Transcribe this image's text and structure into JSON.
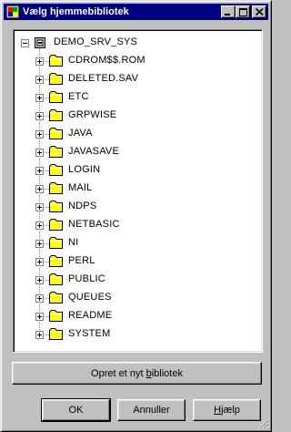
{
  "window": {
    "title": "Vælg hjemmebibliotek",
    "icon": "app-icon",
    "controls": [
      "minimize-icon",
      "maximize-icon",
      "close-icon"
    ]
  },
  "tree": {
    "root": {
      "label": "DEMO_SRV_SYS",
      "icon": "server-volume-icon",
      "expanded": true
    },
    "folders": [
      {
        "label": "CDROM$$.ROM"
      },
      {
        "label": "DELETED.SAV"
      },
      {
        "label": "ETC"
      },
      {
        "label": "GRPWISE"
      },
      {
        "label": "JAVA"
      },
      {
        "label": "JAVASAVE"
      },
      {
        "label": "LOGIN"
      },
      {
        "label": "MAIL"
      },
      {
        "label": "NDPS"
      },
      {
        "label": "NETBASIC"
      },
      {
        "label": "NI"
      },
      {
        "label": "PERL"
      },
      {
        "label": "PUBLIC"
      },
      {
        "label": "QUEUES"
      },
      {
        "label": "README"
      },
      {
        "label": "SYSTEM"
      }
    ]
  },
  "buttons": {
    "new_library": {
      "before": "Opret et nyt ",
      "underlined": "b",
      "after": "ibliotek"
    },
    "ok": "OK",
    "cancel": "Annuller",
    "help": {
      "underlined": "H",
      "after": "jælp"
    }
  },
  "colors": {
    "titlebar": "#000080",
    "folder": "#ffff00",
    "face": "#c0c0c0"
  }
}
